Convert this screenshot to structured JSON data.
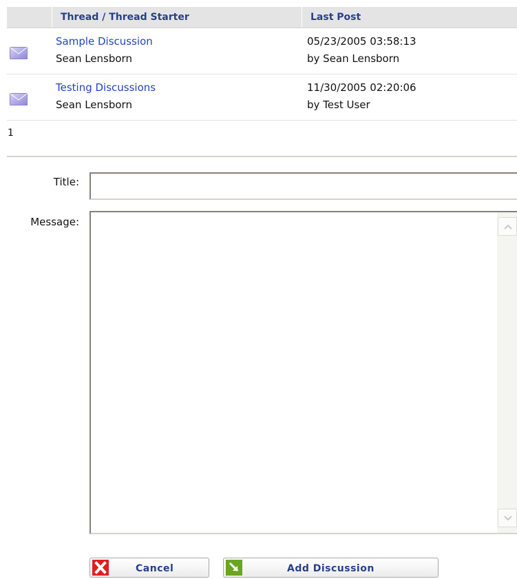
{
  "table": {
    "headers": {
      "thread": "Thread / Thread Starter",
      "last_post": "Last Post"
    },
    "rows": [
      {
        "title": "Sample Discussion",
        "starter": "Sean Lensborn",
        "last_post_date": "05/23/2005 03:58:13",
        "last_post_by": "by Sean Lensborn",
        "icon": "envelope-icon"
      },
      {
        "title": "Testing Discussions",
        "starter": "Sean Lensborn",
        "last_post_date": "11/30/2005 02:20:06",
        "last_post_by": "by Test User",
        "icon": "envelope-icon"
      }
    ],
    "pager": "1"
  },
  "form": {
    "title_label": "Title:",
    "title_value": "",
    "message_label": "Message:",
    "message_value": ""
  },
  "buttons": {
    "cancel": {
      "label": "Cancel",
      "icon": "cancel-x-icon",
      "color": "#e02020"
    },
    "add": {
      "label": "Add Discussion",
      "icon": "arrow-down-right-icon",
      "color": "#6aa520"
    }
  },
  "colors": {
    "link": "#2244bb",
    "header_text": "#27408b",
    "header_bg": "#e4e4e4"
  }
}
